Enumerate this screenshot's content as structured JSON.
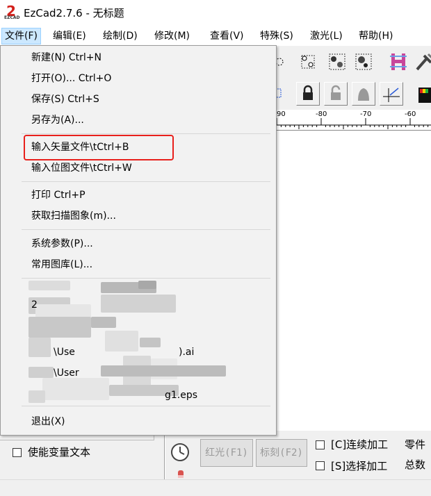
{
  "window": {
    "title": "EzCad2.7.6 - 无标题"
  },
  "app_icon": {
    "label_top": "2",
    "label_bottom": "EZCAD"
  },
  "menubar": {
    "items": [
      {
        "label": "文件(F)"
      },
      {
        "label": "编辑(E)"
      },
      {
        "label": "绘制(D)"
      },
      {
        "label": "修改(M)"
      },
      {
        "label": "查看(V)"
      },
      {
        "label": "特殊(S)"
      },
      {
        "label": "激光(L)"
      },
      {
        "label": "帮助(H)"
      }
    ]
  },
  "file_menu": {
    "new": "新建(N) Ctrl+N",
    "open": "打开(O)... Ctrl+O",
    "save": "保存(S) Ctrl+S",
    "save_as": "另存为(A)...",
    "import_vector": "输入矢量文件\\tCtrl+B",
    "import_bitmap": "输入位图文件\\tCtrl+W",
    "print": "打印 Ctrl+P",
    "scan": "获取扫描图象(m)...",
    "system_params": "系统参数(P)...",
    "library": "常用图库(L)...",
    "recent_fragment_1": "\\Use",
    "recent_fragment_1_tail": ").ai",
    "recent_fragment_2": "\\User",
    "recent_fragment_3": "g1.eps",
    "recent_fragment_4": "2",
    "exit": "退出(X)"
  },
  "ruler": {
    "labels": [
      "90",
      "-80",
      "-70",
      "-60"
    ]
  },
  "bottom": {
    "enable_var_text": "使能变量文本",
    "red_light": "红光(F1)",
    "mark": "标刻(F2)",
    "continuous": "[C]连续加工",
    "selected": "[S]选择加工",
    "parts": "零件",
    "total": "总数"
  },
  "colors": {
    "highlight": "#e8201c",
    "menu_active_bg": "#cce8ff",
    "icon_red": "#d3201b"
  }
}
